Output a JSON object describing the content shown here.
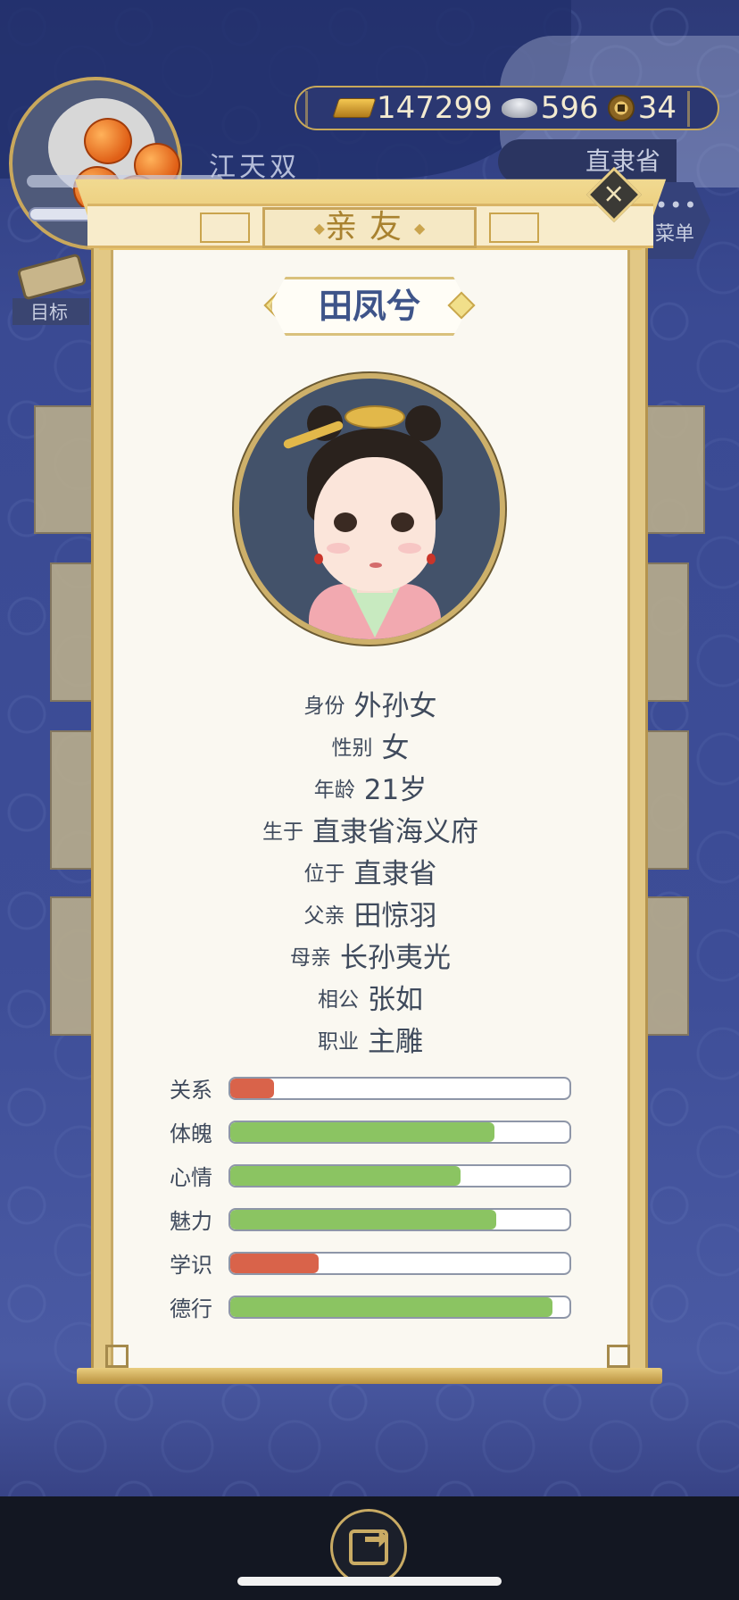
{
  "currency": {
    "gold": "147299",
    "silver": "596",
    "coins": "34"
  },
  "player": {
    "name": "江天双"
  },
  "location_tag": "直隶省",
  "menu": {
    "label": "菜单"
  },
  "goal": {
    "label": "目标"
  },
  "modal": {
    "title": "亲友",
    "close_icon": "close-icon"
  },
  "relative": {
    "name": "田凤兮",
    "info": [
      {
        "label": "身份",
        "value": "外孙女"
      },
      {
        "label": "性别",
        "value": "女"
      },
      {
        "label": "年龄",
        "value": "21岁"
      },
      {
        "label": "生于",
        "value": "直隶省海义府"
      },
      {
        "label": "位于",
        "value": "直隶省"
      },
      {
        "label": "父亲",
        "value": "田惊羽"
      },
      {
        "label": "母亲",
        "value": "长孙夷光"
      },
      {
        "label": "相公",
        "value": "张如"
      },
      {
        "label": "职业",
        "value": "主雕"
      }
    ],
    "stats": [
      {
        "label": "关系",
        "level": 0.13,
        "color": "#d9634a"
      },
      {
        "label": "体魄",
        "level": 0.78,
        "color": "#8bc462"
      },
      {
        "label": "心情",
        "level": 0.68,
        "color": "#8bc462"
      },
      {
        "label": "魅力",
        "level": 0.785,
        "color": "#8bc462"
      },
      {
        "label": "学识",
        "level": 0.26,
        "color": "#d9634a"
      },
      {
        "label": "德行",
        "level": 0.95,
        "color": "#8bc462"
      }
    ]
  },
  "bottom": {
    "share_icon": "share-icon"
  }
}
